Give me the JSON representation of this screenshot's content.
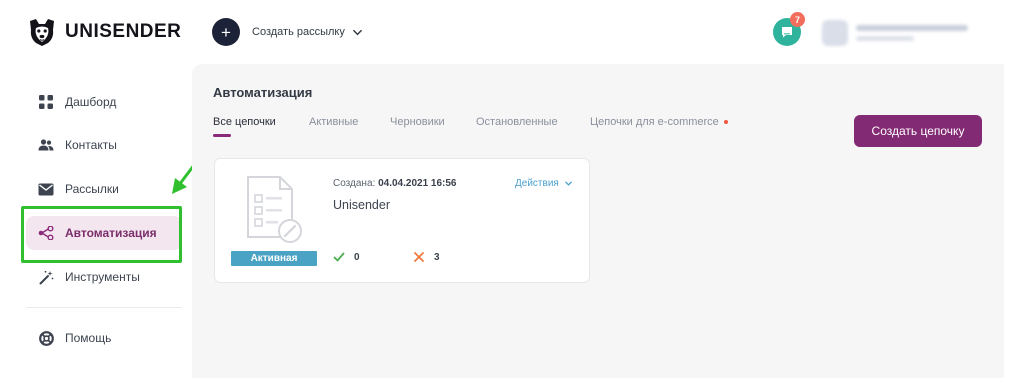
{
  "brand": {
    "name": "UNISENDER"
  },
  "topbar": {
    "create_newsletter_label": "Создать рассылку",
    "notifications_count": "7"
  },
  "sidebar": {
    "items": [
      {
        "label": "Дашборд",
        "icon": "dashboard-grid-icon"
      },
      {
        "label": "Контакты",
        "icon": "contacts-people-icon"
      },
      {
        "label": "Рассылки",
        "icon": "envelope-icon"
      },
      {
        "label": "Автоматизация",
        "icon": "automation-nodes-icon",
        "active": true
      },
      {
        "label": "Инструменты",
        "icon": "magic-wand-icon"
      },
      {
        "label": "Помощь",
        "icon": "lifebuoy-icon"
      }
    ]
  },
  "main": {
    "title": "Автоматизация",
    "tabs": [
      {
        "label": "Все цепочки",
        "active": true
      },
      {
        "label": "Активные"
      },
      {
        "label": "Черновики"
      },
      {
        "label": "Остановленные"
      },
      {
        "label": "Цепочки для e-commerce",
        "has_dot": true
      }
    ],
    "create_chain_label": "Создать цепочку",
    "card": {
      "status": "Активная",
      "created_prefix": "Создана:",
      "created_date": "04.04.2021 16:56",
      "name": "Unisender",
      "actions_label": "Действия",
      "success_count": "0",
      "failed_count": "3"
    }
  },
  "colors": {
    "accent": "#832a74",
    "active_nav_bg": "#f4e6ef",
    "status_badge": "#4aa3c4",
    "support": "#2fb39c",
    "annotation_green": "#2fbf2f"
  }
}
